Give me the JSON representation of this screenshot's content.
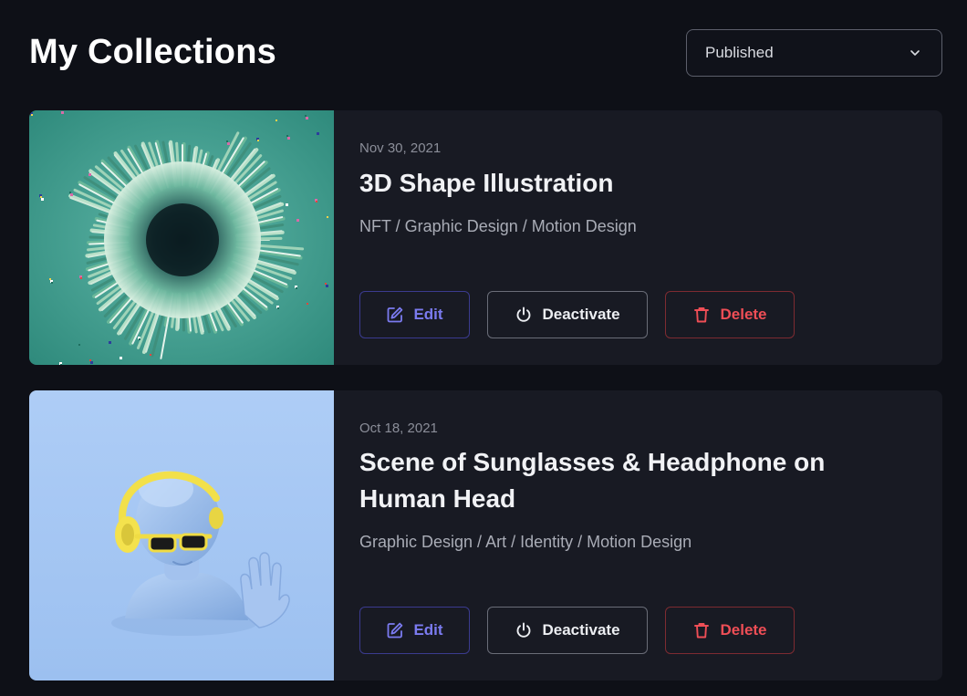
{
  "header": {
    "title": "My Collections",
    "status_select": {
      "value": "Published",
      "icon": "chevron-down-icon"
    }
  },
  "collections": [
    {
      "date": "Nov 30, 2021",
      "title": "3D Shape Illustration",
      "tags": "NFT / Graphic Design / Motion Design",
      "thumbnail": "teal-3d-shape-explosion",
      "actions": {
        "edit": "Edit",
        "deactivate": "Deactivate",
        "delete": "Delete"
      }
    },
    {
      "date": "Oct 18, 2021",
      "title": "Scene of Sunglasses & Headphone on Human Head",
      "tags": "Graphic Design / Art / Identity / Motion Design",
      "thumbnail": "blue-bust-with-headphones-and-sunglasses",
      "actions": {
        "edit": "Edit",
        "deactivate": "Deactivate",
        "delete": "Delete"
      }
    }
  ],
  "colors": {
    "background": "#0e1017",
    "card": "#181a23",
    "edit": "#7b7bf0",
    "delete": "#ef4e56"
  }
}
